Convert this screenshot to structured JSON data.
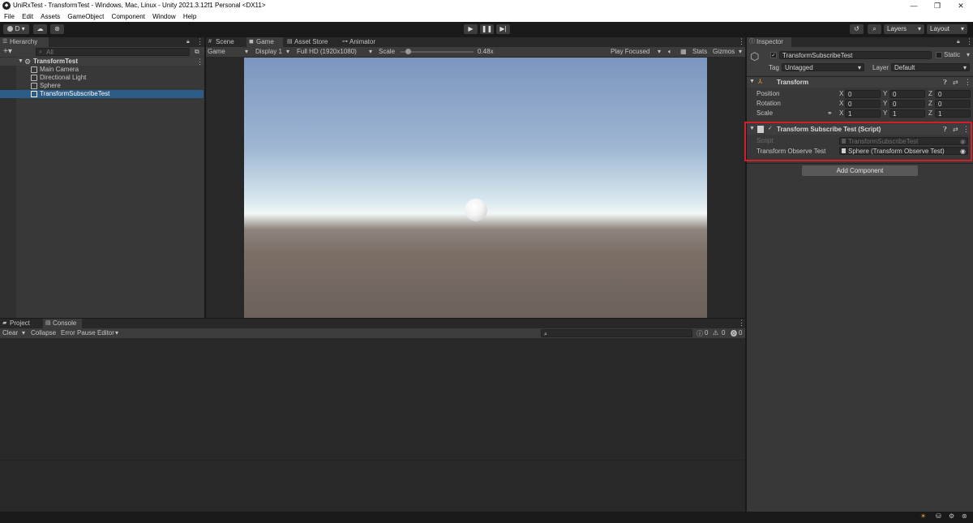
{
  "window": {
    "title": "UniRxTest - TransformTest - Windows, Mac, Linux - Unity 2021.3.12f1 Personal <DX11>",
    "minimize": "—",
    "maximize": "❐",
    "close": "✕"
  },
  "menu": [
    "File",
    "Edit",
    "Assets",
    "GameObject",
    "Component",
    "Window",
    "Help"
  ],
  "toolbar": {
    "account_label": "D",
    "layers_label": "Layers",
    "layout_label": "Layout"
  },
  "hierarchy": {
    "tab_label": "Hierarchy",
    "search_placeholder": "All",
    "scene_name": "TransformTest",
    "items": [
      "Main Camera",
      "Directional Light",
      "Sphere",
      "TransformSubscribeTest"
    ],
    "selected_item": "TransformSubscribeTest"
  },
  "center_tabs": [
    "Scene",
    "Game",
    "Asset Store",
    "Animator"
  ],
  "game_toolbar": {
    "mode": "Game",
    "display": "Display 1",
    "resolution": "Full HD (1920x1080)",
    "scale_label": "Scale",
    "scale_value": "0.48x",
    "scale_slider": 0.1,
    "play_focused": "Play Focused",
    "stats": "Stats",
    "gizmos": "Gizmos"
  },
  "bottom_tabs": [
    "Project",
    "Console"
  ],
  "console_toolbar": {
    "clear": "Clear",
    "collapse": "Collapse",
    "error_pause": "Error Pause",
    "editor": "Editor",
    "info_count": "0",
    "warning_count": "0",
    "error_count": "0"
  },
  "inspector": {
    "tab_label": "Inspector",
    "object_name": "TransformSubscribeTest",
    "static_label": "Static",
    "tag_label": "Tag",
    "tag_value": "Untagged",
    "layer_label": "Layer",
    "layer_value": "Default",
    "transform": {
      "header": "Transform",
      "rows": [
        {
          "label": "Position",
          "x": "0",
          "y": "0",
          "z": "0"
        },
        {
          "label": "Rotation",
          "x": "0",
          "y": "0",
          "z": "0"
        },
        {
          "label": "Scale",
          "x": "1",
          "y": "1",
          "z": "1"
        }
      ],
      "axis_x": "X",
      "axis_y": "Y",
      "axis_z": "Z"
    },
    "script_component": {
      "header": "Transform Subscribe Test (Script)",
      "script_label": "Script",
      "script_value": "TransformSubscribeTest",
      "field_label": "Transform Observe Test",
      "field_value": "Sphere (Transform Observe Test)"
    },
    "add_component": "Add Component",
    "highlight_color": "#d0202a"
  }
}
